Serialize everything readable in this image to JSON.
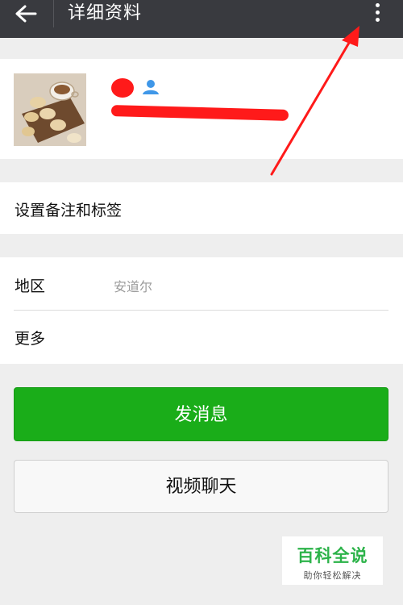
{
  "header": {
    "title": "详细资料"
  },
  "rows": {
    "tags_label": "设置备注和标签",
    "region_label": "地区",
    "region_value": "安道尔",
    "more_label": "更多"
  },
  "buttons": {
    "send_message": "发消息",
    "video_chat": "视频聊天"
  },
  "watermark": {
    "title": "百科全说",
    "subtitle": "助你轻松解决"
  },
  "colors": {
    "topbar": "#393a3f",
    "primary_green": "#1aad19",
    "annotation_red": "#ff1a1a",
    "watermark_green": "#2db34a"
  },
  "icons": [
    "back-arrow-icon",
    "more-vertical-icon",
    "contact-person-icon"
  ]
}
